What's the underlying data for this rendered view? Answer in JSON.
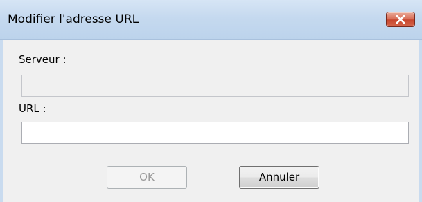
{
  "window": {
    "title": "Modifier l'adresse URL",
    "close_icon": "close-icon"
  },
  "form": {
    "server_label": "Serveur :",
    "server_value": "",
    "url_label": "URL :",
    "url_value": ""
  },
  "buttons": {
    "ok_label": "OK",
    "cancel_label": "Annuler"
  },
  "colors": {
    "titlebar": "#c5d9ef",
    "close_button": "#c7462e",
    "client_background": "#f0f0f0"
  }
}
